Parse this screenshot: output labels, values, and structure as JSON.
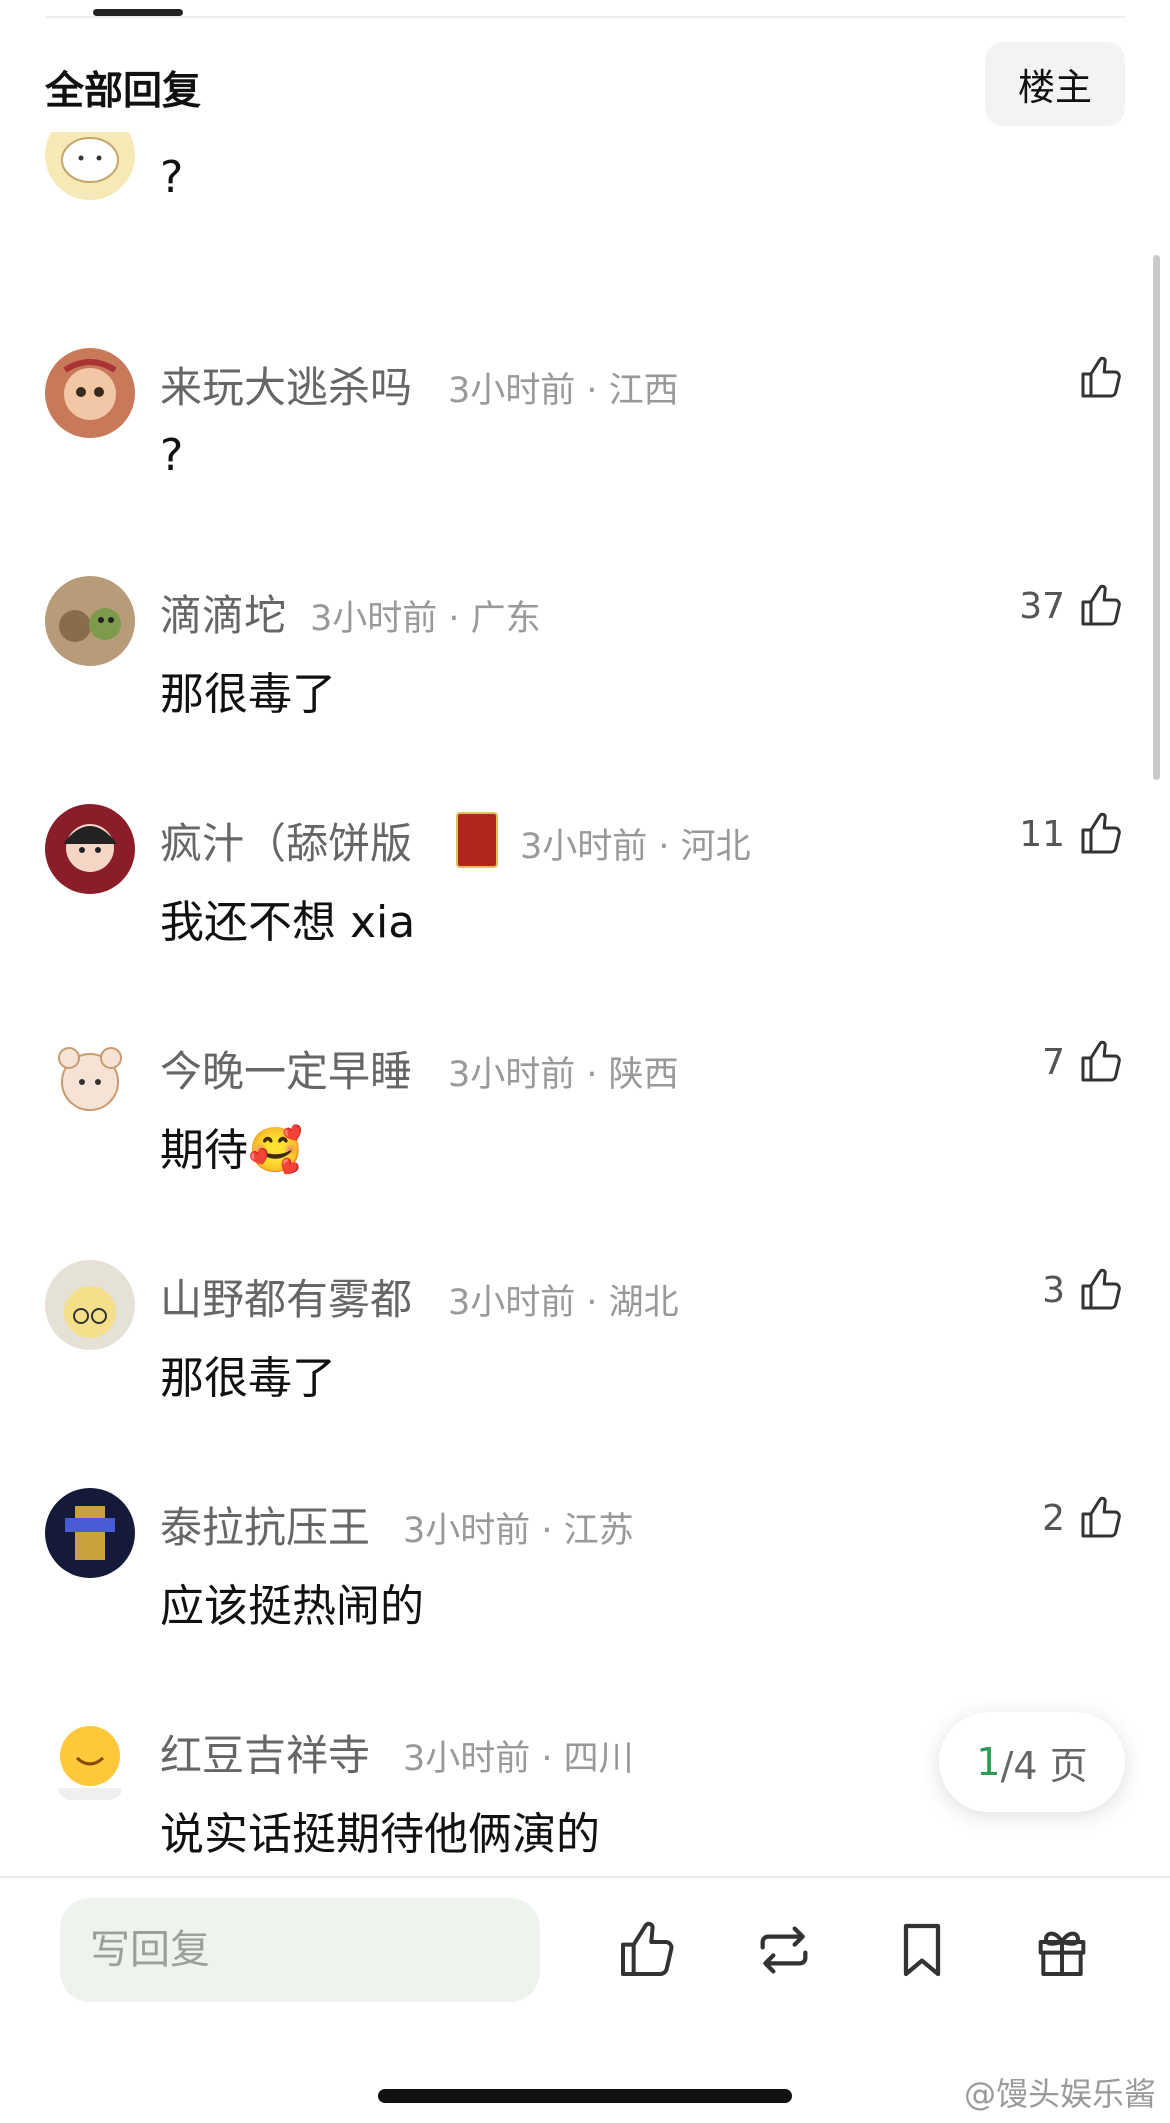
{
  "header": {
    "title": "全部回复",
    "op_button_label": "楼主"
  },
  "partial_comment": {
    "body": "?"
  },
  "comments": [
    {
      "username": "来玩大逃杀吗",
      "time_location": "3小时前 · 江西",
      "body": "?",
      "likes": ""
    },
    {
      "username": "滴滴坨",
      "time_location": "3小时前 · 广东",
      "body": "那很毒了",
      "likes": "37"
    },
    {
      "username": "疯汁（舔饼版",
      "time_location": "3小时前 · 河北",
      "body": "我还不想 xia",
      "likes": "11"
    },
    {
      "username": "今晚一定早睡",
      "time_location": "3小时前 · 陕西",
      "body": "期待🥰",
      "likes": "7"
    },
    {
      "username": "山野都有雾都",
      "time_location": "3小时前 · 湖北",
      "body": "那很毒了",
      "likes": "3"
    },
    {
      "username": "泰拉抗压王",
      "time_location": "3小时前 · 江苏",
      "body": "应该挺热闹的",
      "likes": "2"
    },
    {
      "username": "红豆吉祥寺",
      "time_location": "3小时前 · 四川",
      "body": "说实话挺期待他俩演的",
      "likes": ""
    }
  ],
  "pagination": {
    "current": "1",
    "rest": "/4 页"
  },
  "bottom_bar": {
    "reply_placeholder": "写回复",
    "icons": [
      "thumbs-up-icon",
      "repost-icon",
      "bookmark-icon",
      "gift-icon"
    ]
  },
  "watermark": "@馒头娱乐酱",
  "colors": {
    "accent_green": "#2e9a55",
    "input_bg": "#eef3ee"
  }
}
